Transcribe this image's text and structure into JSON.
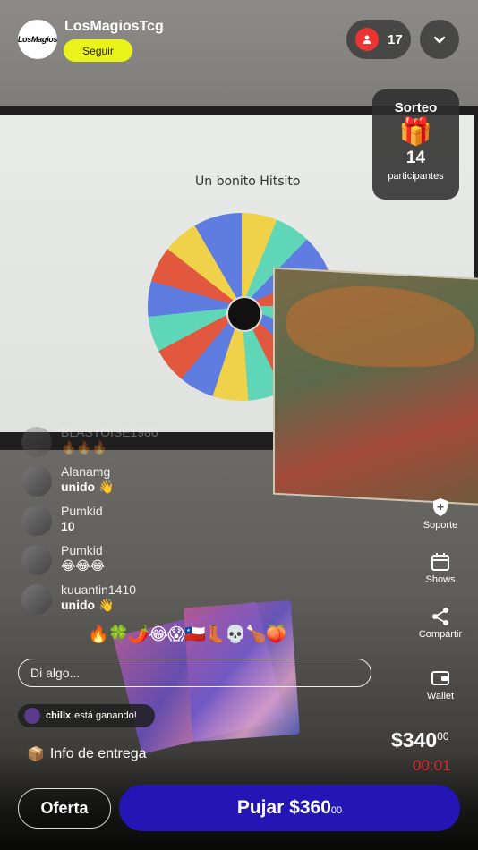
{
  "header": {
    "avatar_text": "LosMagios",
    "streamer_name": "LosMagiosTcg",
    "follow_label": "Seguir",
    "viewer_count": "17"
  },
  "scene": {
    "wheel_title": "Un bonito Hitsito"
  },
  "giveaway": {
    "title": "Sorteo",
    "gift_icon": "🎁",
    "count": "14",
    "participants_label": "participantes"
  },
  "chat": {
    "messages": [
      {
        "user": "BLASTOISE1986",
        "text": "🔥🔥🔥"
      },
      {
        "user": "Alanamg",
        "text": "unido 👋"
      },
      {
        "user": "Pumkid",
        "text": "10"
      },
      {
        "user": "Pumkid",
        "text": "😂😂😂"
      },
      {
        "user": "kuuantin1410",
        "text": "unido 👋"
      }
    ],
    "reactions": "🔥🍀🌶️😂😱🇨🇱👢💀🍗🍑",
    "input_placeholder": "Di algo...",
    "winner_user": "chillx",
    "winner_text": "está ganando!"
  },
  "delivery": {
    "icon": "📦",
    "label": "Info de entrega"
  },
  "rail": {
    "support": "Soporte",
    "shows": "Shows",
    "share": "Compartir",
    "wallet": "Wallet"
  },
  "auction": {
    "price_main": "$340",
    "price_cents": "00",
    "timer": "00:01",
    "offer_label": "Oferta",
    "bid_main": "Pujar $360",
    "bid_cents": "00"
  },
  "colors": {
    "follow_bg": "#eaf21c",
    "bid_bg": "#2316b5",
    "timer": "#e0282d",
    "viewer_dot": "#ee3333"
  }
}
